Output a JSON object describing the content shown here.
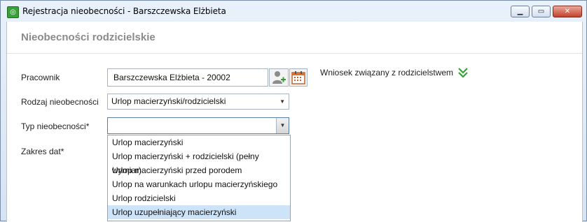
{
  "window": {
    "title": "Rejestracja nieobecności - Barszczewska Elżbieta",
    "controls": {
      "minimize": "▁",
      "maximize": "▭",
      "close": "✕"
    }
  },
  "header": {
    "title": "Nieobecności rodzicielskie"
  },
  "form": {
    "employee_label": "Pracownik",
    "employee_value": "Barszczewska Elżbieta - 20002",
    "absence_kind_label": "Rodzaj nieobecności",
    "absence_kind_value": "Urlop macierzyński/rodzicielski",
    "absence_type_label": "Typ nieobecności*",
    "absence_type_value": "",
    "date_range_label": "Zakres dat*"
  },
  "side": {
    "wniosek_label": "Wniosek związany z rodzicielstwem"
  },
  "dropdown": {
    "items": [
      "Urlop macierzyński",
      "Urlop macierzyński + rodzicielski (pełny wymiar)",
      "Urlop macierzyński przed porodem",
      "Urlop na warunkach urlopu macierzyńskiego",
      "Urlop rodzicielski",
      "Urlop uzupełniający macierzyński"
    ],
    "highlighted": "Urlop uzupełniający macierzyński"
  },
  "icons": {
    "app": "app-icon",
    "user_add": "user-add-icon",
    "calendar": "calendar-icon",
    "expand": "double-chevron-down-icon"
  },
  "colors": {
    "accent_green": "#3aa03a",
    "selection": "#cde3f7",
    "close_red": "#c4412d"
  }
}
